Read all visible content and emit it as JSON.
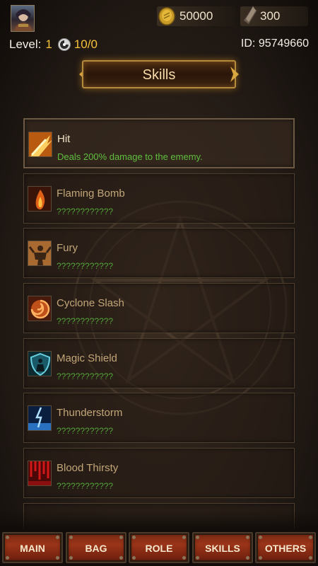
{
  "header": {
    "gold": "50000",
    "gems": "300",
    "level_label": "Level:",
    "level_value": "1",
    "exp_current": "10",
    "exp_separator": "/",
    "exp_max": "0",
    "player_id": "ID: 95749660"
  },
  "banner": {
    "title": "Skills"
  },
  "skills": [
    {
      "name": "Hit",
      "desc": "Deals 200% damage to the ememy.",
      "icon": "slash-burst-icon"
    },
    {
      "name": "Flaming Bomb",
      "desc": "????????????",
      "icon": "flame-icon"
    },
    {
      "name": "Fury",
      "desc": "????????????",
      "icon": "warrior-rage-icon"
    },
    {
      "name": "Cyclone Slash",
      "desc": "????????????",
      "icon": "cyclone-icon"
    },
    {
      "name": "Magic Shield",
      "desc": "????????????",
      "icon": "shield-icon"
    },
    {
      "name": "Thunderstorm",
      "desc": "????????????",
      "icon": "lightning-icon"
    },
    {
      "name": "Blood Thirsty",
      "desc": "????????????",
      "icon": "blood-icon"
    }
  ],
  "nav": {
    "items": [
      {
        "label": "MAIN"
      },
      {
        "label": "BAG"
      },
      {
        "label": "ROLE"
      },
      {
        "label": "SKILLS"
      },
      {
        "label": "OTHERS"
      }
    ]
  },
  "colors": {
    "accent_gold": "#f6c23a",
    "skill_desc_green": "#52a238",
    "nav_red": "#9a3418"
  }
}
